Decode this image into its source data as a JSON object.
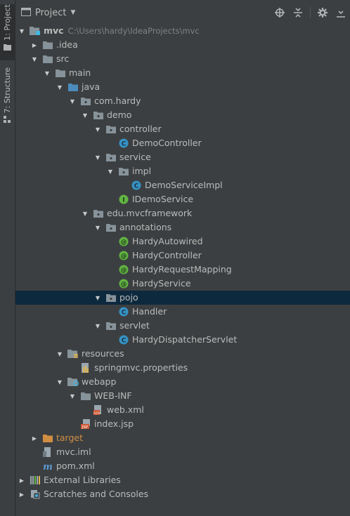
{
  "side_tabs": {
    "project": "1: Project",
    "structure": "7: Structure"
  },
  "header": {
    "title": "Project",
    "icons": [
      "target-icon",
      "collapse-all-icon",
      "gear-icon",
      "hide-icon"
    ]
  },
  "tree": {
    "items": [
      {
        "label": "mvc",
        "path": "C:\\Users\\hardy\\IdeaProjects\\mvc",
        "depth": 0,
        "arrow": "down",
        "icon": "module-folder"
      },
      {
        "label": ".idea",
        "depth": 1,
        "arrow": "right",
        "icon": "folder"
      },
      {
        "label": "src",
        "depth": 1,
        "arrow": "down",
        "icon": "folder"
      },
      {
        "label": "main",
        "depth": 2,
        "arrow": "down",
        "icon": "folder"
      },
      {
        "label": "java",
        "depth": 3,
        "arrow": "down",
        "icon": "source-folder"
      },
      {
        "label": "com.hardy",
        "depth": 4,
        "arrow": "down",
        "icon": "package"
      },
      {
        "label": "demo",
        "depth": 5,
        "arrow": "down",
        "icon": "package"
      },
      {
        "label": "controller",
        "depth": 6,
        "arrow": "down",
        "icon": "package"
      },
      {
        "label": "DemoController",
        "depth": 7,
        "icon": "class"
      },
      {
        "label": "service",
        "depth": 6,
        "arrow": "down",
        "icon": "package"
      },
      {
        "label": "impl",
        "depth": 7,
        "arrow": "down",
        "icon": "package"
      },
      {
        "label": "DemoServiceImpl",
        "depth": 8,
        "icon": "class"
      },
      {
        "label": "IDemoService",
        "depth": 7,
        "icon": "interface"
      },
      {
        "label": "edu.mvcframework",
        "depth": 5,
        "arrow": "down",
        "icon": "package"
      },
      {
        "label": "annotations",
        "depth": 6,
        "arrow": "down",
        "icon": "package"
      },
      {
        "label": "HardyAutowired",
        "depth": 7,
        "icon": "annotation"
      },
      {
        "label": "HardyController",
        "depth": 7,
        "icon": "annotation"
      },
      {
        "label": "HardyRequestMapping",
        "depth": 7,
        "icon": "annotation"
      },
      {
        "label": "HardyService",
        "depth": 7,
        "icon": "annotation"
      },
      {
        "label": "pojo",
        "depth": 6,
        "arrow": "down",
        "icon": "package",
        "selected": true
      },
      {
        "label": "Handler",
        "depth": 7,
        "icon": "class"
      },
      {
        "label": "servlet",
        "depth": 6,
        "arrow": "down",
        "icon": "package"
      },
      {
        "label": "HardyDispatcherServlet",
        "depth": 7,
        "icon": "class"
      },
      {
        "label": "resources",
        "depth": 3,
        "arrow": "down",
        "icon": "resources-folder"
      },
      {
        "label": "springmvc.properties",
        "depth": 4,
        "icon": "properties-file"
      },
      {
        "label": "webapp",
        "depth": 3,
        "arrow": "down",
        "icon": "web-folder"
      },
      {
        "label": "WEB-INF",
        "depth": 4,
        "arrow": "down",
        "icon": "folder"
      },
      {
        "label": "web.xml",
        "depth": 5,
        "icon": "xml-file"
      },
      {
        "label": "index.jsp",
        "depth": 4,
        "icon": "jsp-file"
      },
      {
        "label": "target",
        "depth": 1,
        "arrow": "right",
        "icon": "excluded-folder",
        "muted": true
      },
      {
        "label": "mvc.iml",
        "depth": 1,
        "icon": "iml-file"
      },
      {
        "label": "pom.xml",
        "depth": 1,
        "icon": "maven-file"
      },
      {
        "label": "External Libraries",
        "depth": 0,
        "arrow": "right",
        "icon": "libraries"
      },
      {
        "label": "Scratches and Consoles",
        "depth": 0,
        "arrow": "right",
        "icon": "scratches"
      }
    ]
  },
  "colors": {
    "background": "#3c3f41",
    "selection": "#0d293e",
    "folder": "#87939a",
    "source_folder": "#4a8dbc",
    "class": "#3592c4",
    "interface": "#62b543",
    "annotation": "#62b543",
    "excluded": "#d08e43"
  }
}
